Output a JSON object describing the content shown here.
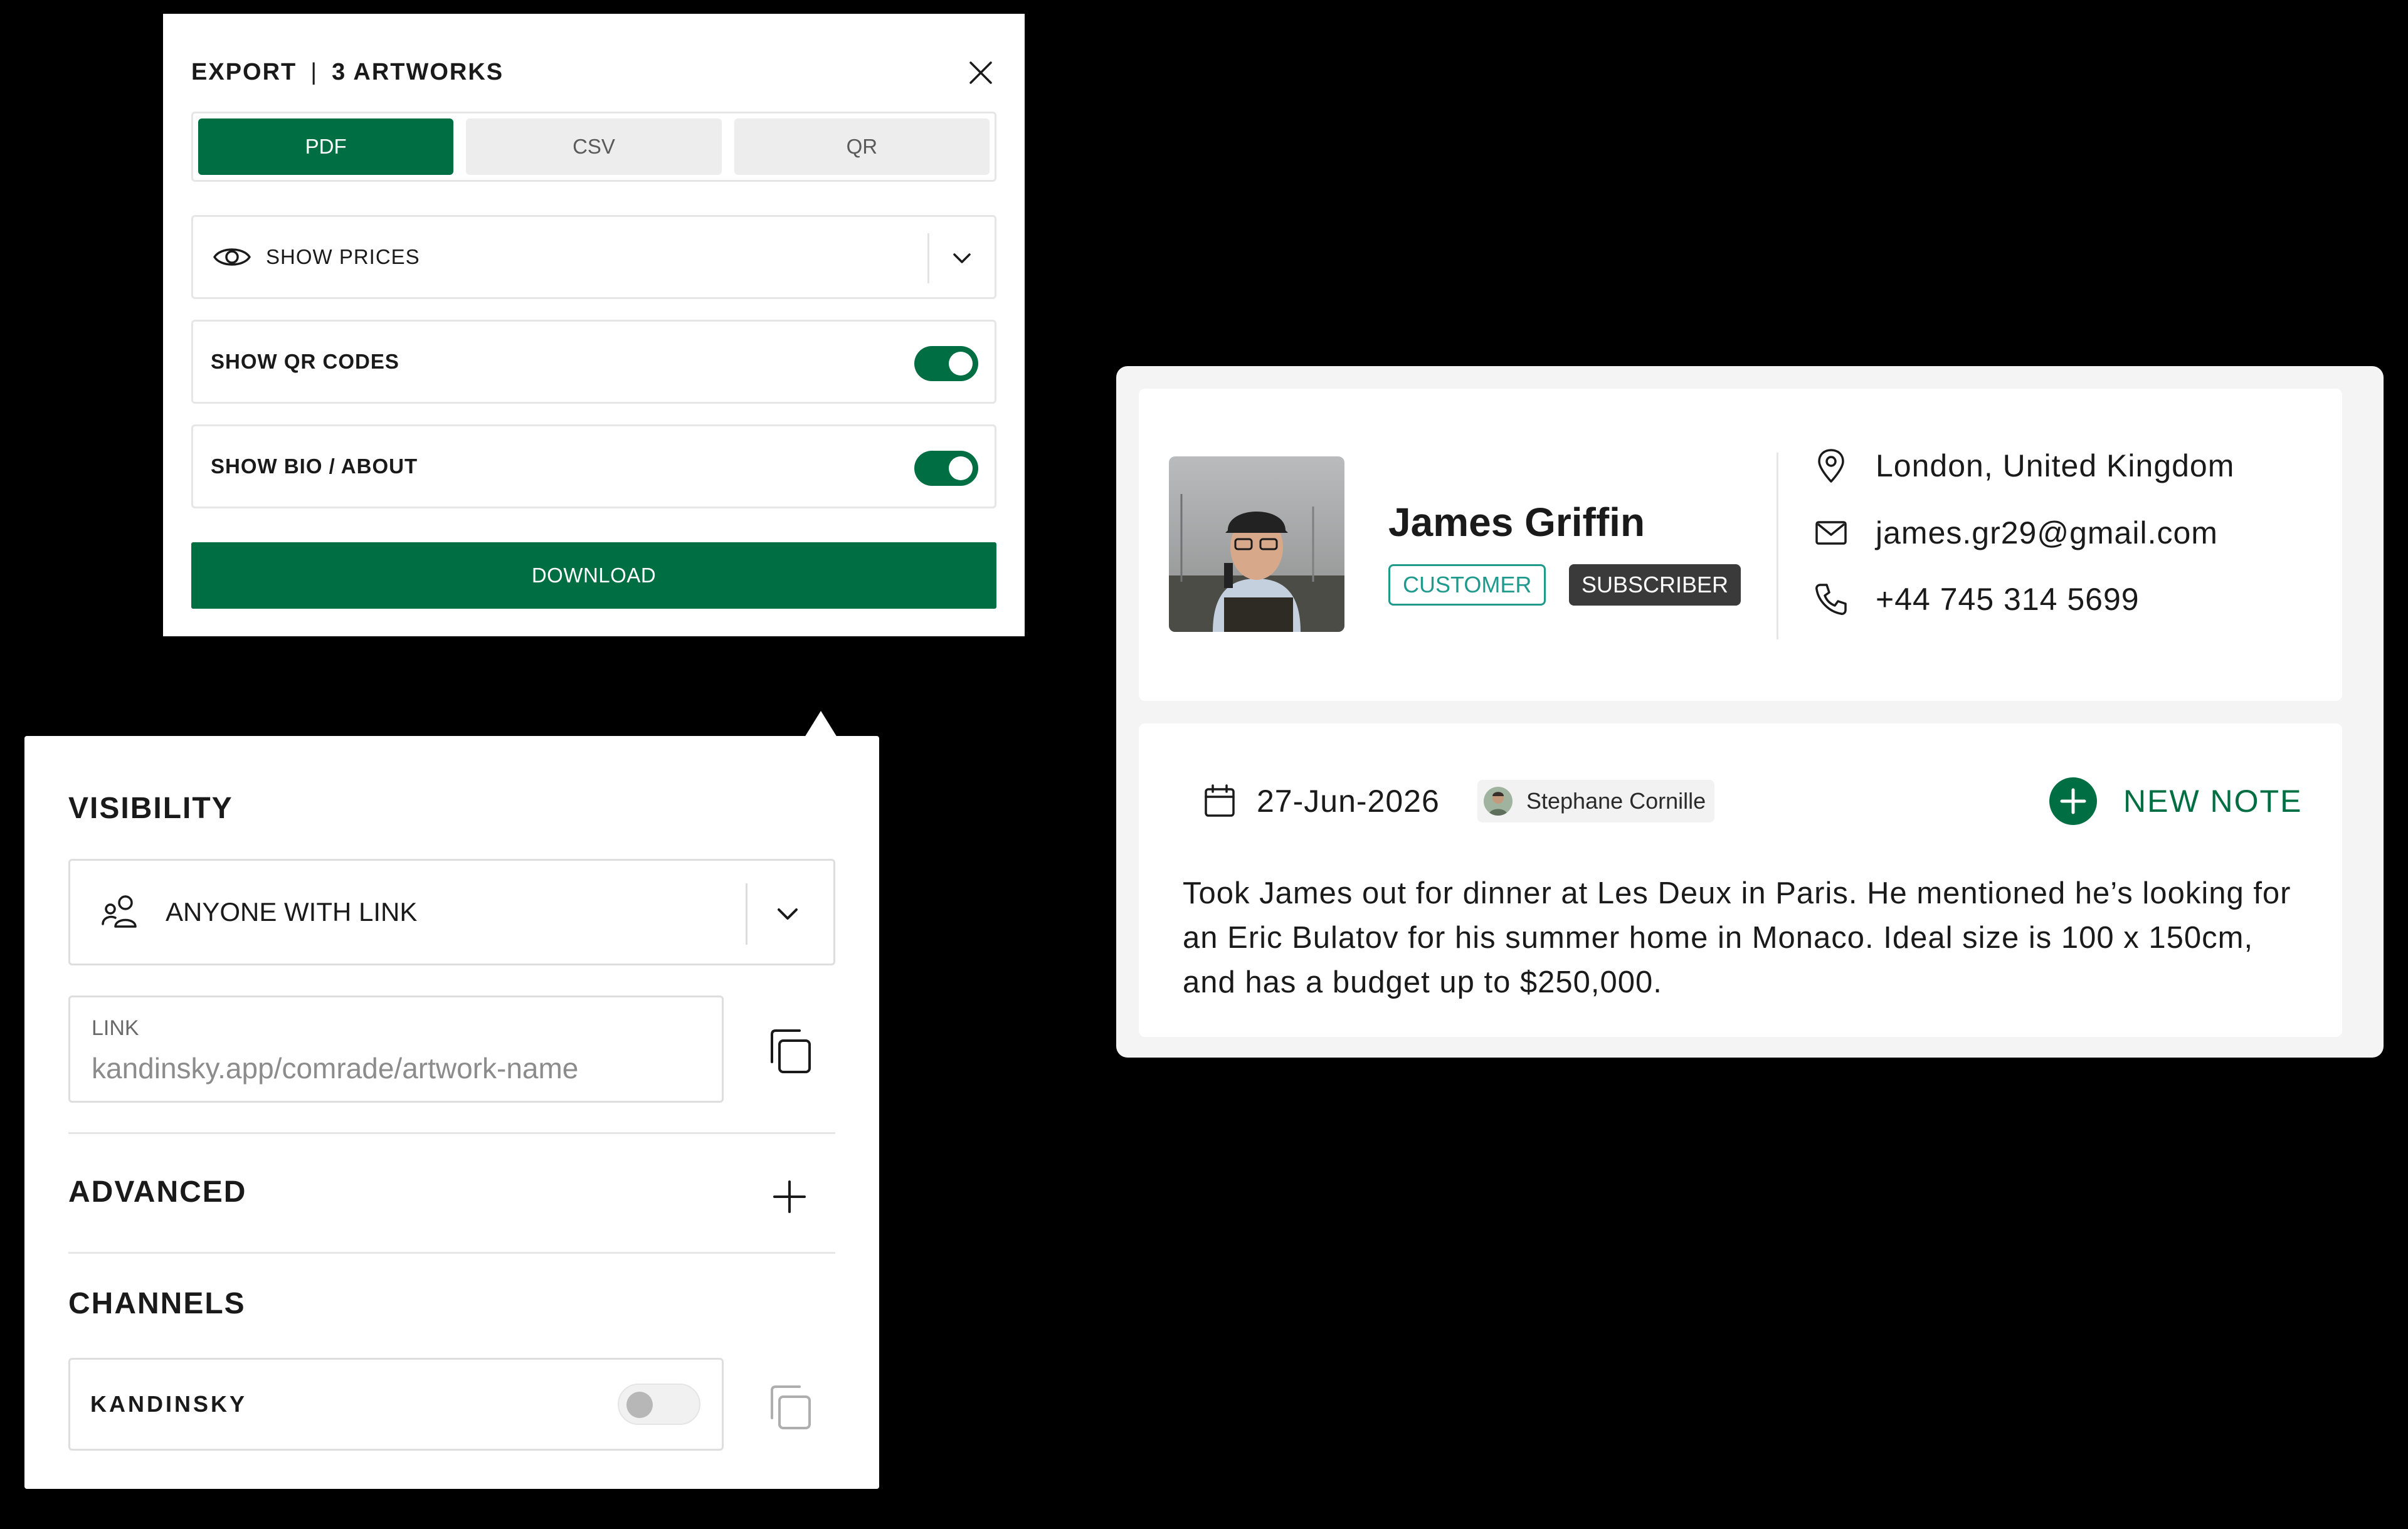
{
  "export_panel": {
    "title_left": "EXPORT",
    "title_sep": "|",
    "title_right": "3 ARTWORKS",
    "formats": [
      "PDF",
      "CSV",
      "QR"
    ],
    "active_format": "PDF",
    "show_prices_label": "SHOW PRICES",
    "show_qr_label": "SHOW QR CODES",
    "show_qr_on": true,
    "show_bio_label": "SHOW BIO / ABOUT",
    "show_bio_on": true,
    "download_label": "DOWNLOAD",
    "accent_color": "#006e43"
  },
  "visibility_panel": {
    "visibility_heading": "VISIBILITY",
    "access_value": "ANYONE WITH LINK",
    "link_label": "LINK",
    "link_placeholder": "kandinsky.app/comrade/artwork-name",
    "advanced_heading": "ADVANCED",
    "channels_heading": "CHANNELS",
    "channels": [
      {
        "name": "KANDINSKY",
        "enabled": false
      }
    ]
  },
  "contact": {
    "name": "James Griffin",
    "badges": [
      "CUSTOMER",
      "SUBSCRIBER"
    ],
    "location": "London, United Kingdom",
    "email": "james.gr29@gmail.com",
    "phone": "+44 745 314 5699",
    "badge_customer_color": "#1f9a8d",
    "badge_subscriber_color": "#3a3a3a"
  },
  "note": {
    "date": "27-Jun-2026",
    "author": "Stephane Cornille",
    "new_note_label": "NEW NOTE",
    "body": "Took James out for dinner at Les Deux in Paris. He mentioned he’s looking for an Eric Bulatov for his summer home in Monaco. Ideal size is 100 x 150cm, and has a budget up to $250,000."
  },
  "icons": [
    "close-icon",
    "eye-icon",
    "chevron-down-icon",
    "users-icon",
    "copy-icon",
    "plus-icon",
    "map-pin-icon",
    "mail-icon",
    "phone-icon",
    "calendar-icon",
    "plus-circle-icon"
  ]
}
